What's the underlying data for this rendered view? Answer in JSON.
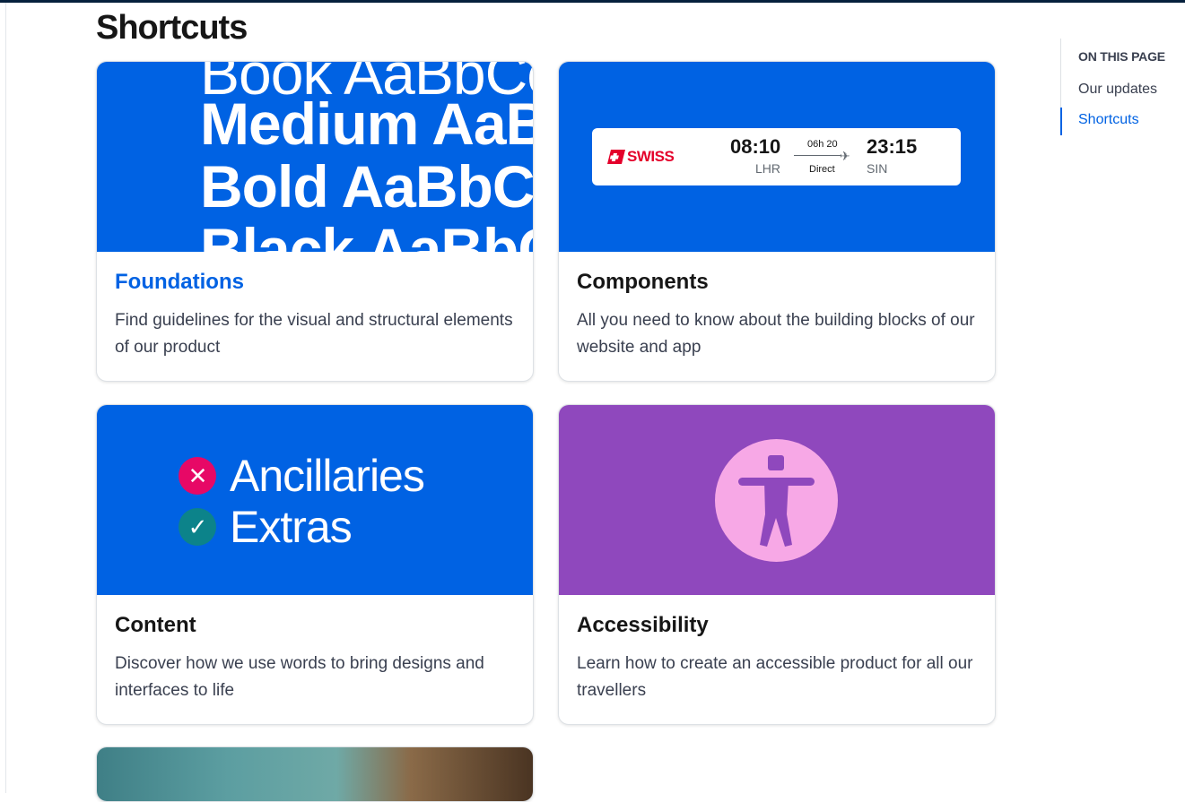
{
  "page": {
    "title": "Shortcuts"
  },
  "cards": [
    {
      "title": "Foundations",
      "description": "Find guidelines for the visual and structural elements of our product",
      "media_color": "#0062e3",
      "type_samples": [
        "Book AaBbCc",
        "Medium AaBb",
        "Bold AaBbCc",
        "Black AaBbCc"
      ]
    },
    {
      "title": "Components",
      "description": "All you need to know about the building blocks of our website and app",
      "media_color": "#0062e3",
      "flight": {
        "airline": "SWISS",
        "depart_time": "08:10",
        "depart_code": "LHR",
        "duration": "06h 20",
        "stops": "Direct",
        "arrive_time": "23:15",
        "arrive_code": "SIN"
      }
    },
    {
      "title": "Content",
      "description": "Discover how we use words to bring designs and interfaces to life",
      "media_color": "#0062e3",
      "lines": [
        {
          "text": "Ancillaries",
          "icon": "cross-icon",
          "icon_color": "#e70866"
        },
        {
          "text": "Extras",
          "icon": "check-icon",
          "icon_color": "#0c838a"
        }
      ]
    },
    {
      "title": "Accessibility",
      "description": "Learn how to create an accessible product for all our travellers",
      "media_color": "#8f48bd",
      "icon": "accessibility-icon",
      "icon_bg": "#f7a8e6",
      "icon_fg": "#8f48bd"
    }
  ],
  "toc": {
    "heading": "ON THIS PAGE",
    "items": [
      {
        "label": "Our updates",
        "active": false
      },
      {
        "label": "Shortcuts",
        "active": true
      }
    ]
  },
  "colors": {
    "primary": "#0062e3",
    "text": "#161616",
    "secondary_text": "#3a4050",
    "border": "#dde1e5"
  }
}
